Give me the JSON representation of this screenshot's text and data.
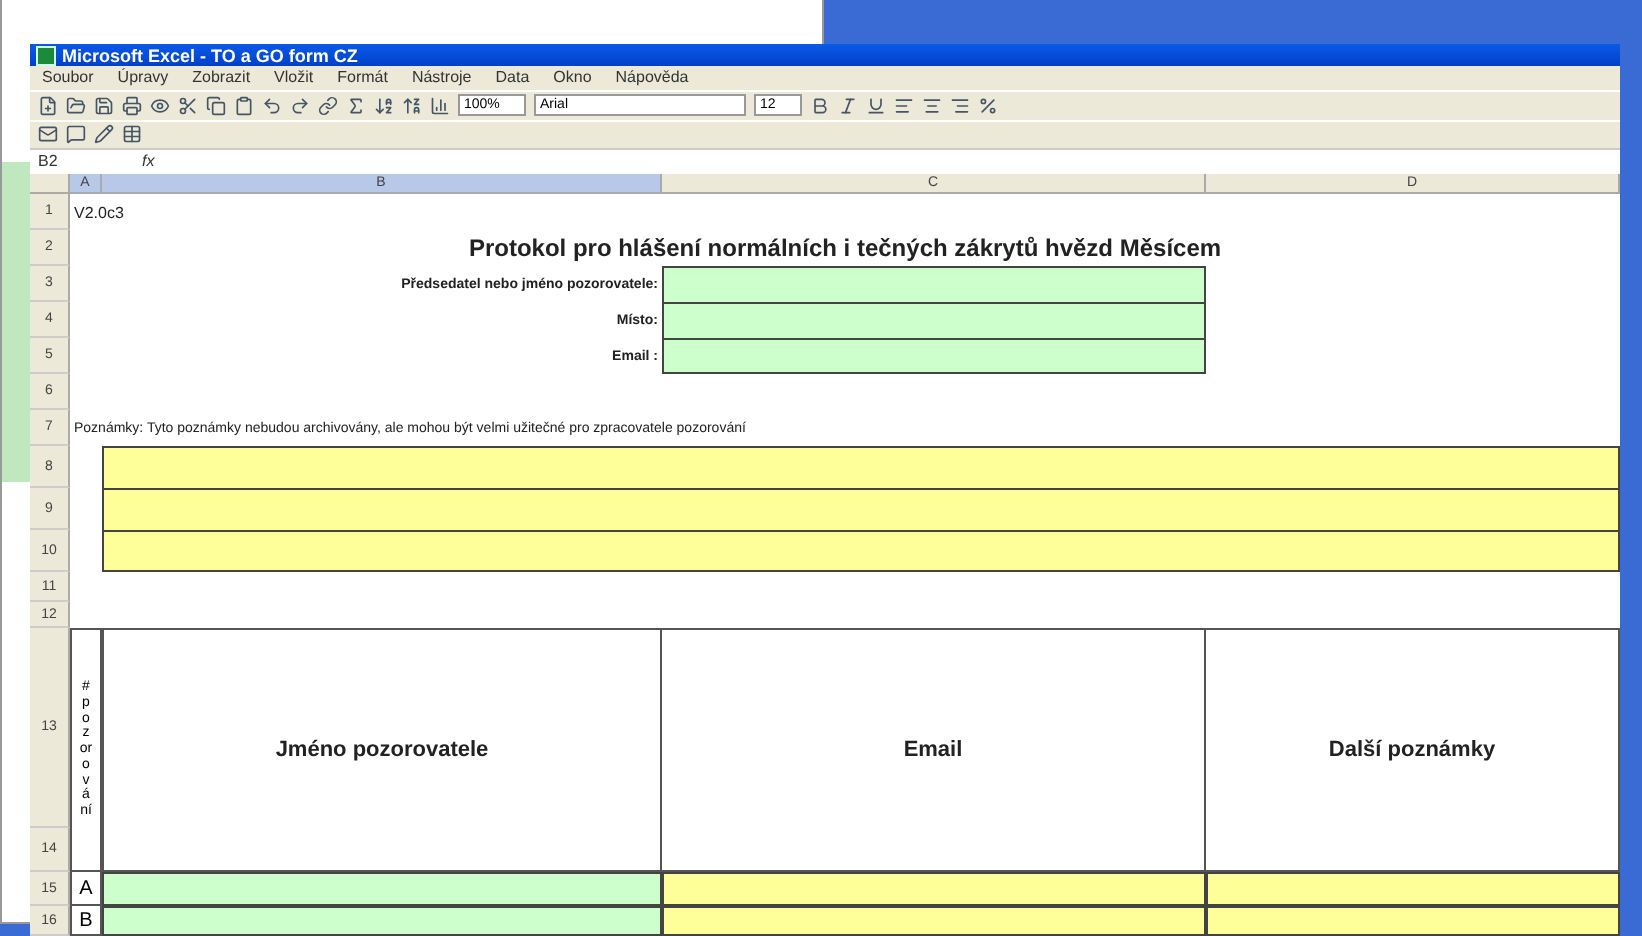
{
  "window": {
    "title": "Microsoft Excel - TO a GO form CZ"
  },
  "menu": [
    "Soubor",
    "Úpravy",
    "Zobrazit",
    "Vložit",
    "Formát",
    "Nástroje",
    "Data",
    "Okno",
    "Nápověda"
  ],
  "formatting": {
    "zoom": "100%",
    "font": "Arial",
    "size": "12"
  },
  "formula_bar": {
    "name_box": "B2",
    "function_label": "fx"
  },
  "columns": [
    {
      "label": "A",
      "selected": true
    },
    {
      "label": "B",
      "selected": true
    },
    {
      "label": "C",
      "selected": false
    },
    {
      "label": "D",
      "selected": false
    }
  ],
  "row_numbers": [
    "1",
    "2",
    "3",
    "4",
    "5",
    "6",
    "7",
    "8",
    "9",
    "10",
    "11",
    "12",
    "13",
    "14",
    "15",
    "16"
  ],
  "sheet": {
    "version": "V2.0c3",
    "title": "Protokol pro hlášení normálních i tečných zákrytů hvězd Měsícem",
    "fields": [
      {
        "label": "Předsedatel nebo jméno pozorovatele:"
      },
      {
        "label": "Místo:"
      },
      {
        "label": "Email :"
      }
    ],
    "note": "Poznámky:  Tyto poznámky nebudou archivovány, ale mohou být velmi užitečné pro zpracovatele pozorování"
  },
  "table": {
    "index_header": "#pozorování",
    "columns": [
      "Jméno pozorovatele",
      "Email",
      "Další poznámky"
    ],
    "rows": [
      {
        "label": "A"
      },
      {
        "label": "B"
      }
    ]
  }
}
